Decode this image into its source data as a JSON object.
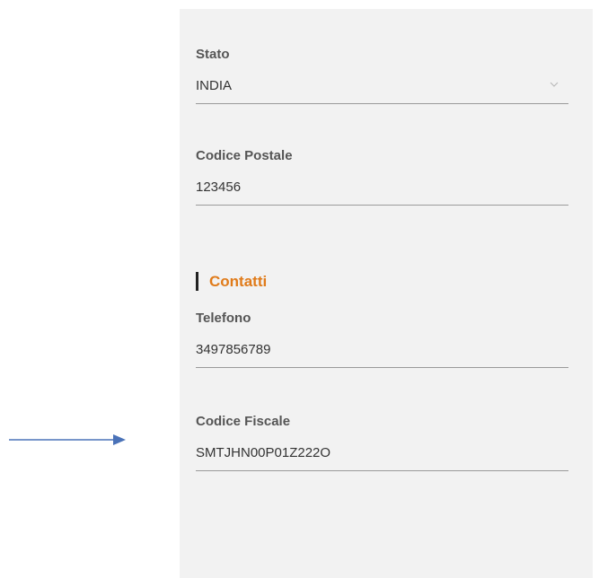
{
  "form": {
    "stato": {
      "label": "Stato",
      "value": "INDIA"
    },
    "codice_postale": {
      "label": "Codice Postale",
      "value": "123456"
    },
    "contatti": {
      "title": "Contatti",
      "telefono": {
        "label": "Telefono",
        "value": "3497856789"
      },
      "codice_fiscale": {
        "label": "Codice Fiscale",
        "value": "SMTJHN00P01Z222O"
      }
    }
  },
  "icons": {
    "dropdown": "chevron-down-icon",
    "pointer": "arrow-right-icon"
  },
  "colors": {
    "accent": "#e07b1a",
    "panel_bg": "#f2f2f2",
    "arrow": "#4a72b8"
  }
}
